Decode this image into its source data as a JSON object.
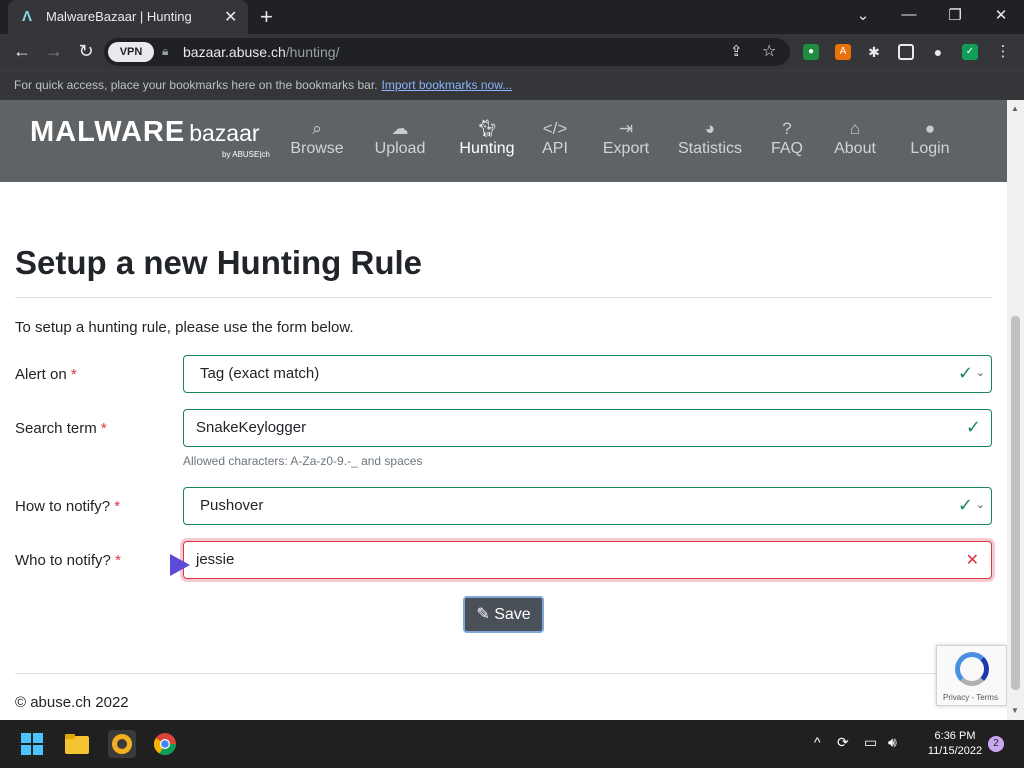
{
  "browser": {
    "tab_title": "MalwareBazaar | Hunting",
    "url_host": "bazaar.abuse.ch",
    "url_path": "/hunting/",
    "vpn_label": "VPN",
    "bookmarks_text": "For quick access, place your bookmarks here on the bookmarks bar.",
    "bookmarks_link": "Import bookmarks now..."
  },
  "site": {
    "logo_main": "MALWARE",
    "logo_sub": "bazaar",
    "logo_by": "by ABUSE|ch",
    "nav": [
      {
        "label": "Browse",
        "icon": "search-icon"
      },
      {
        "label": "Upload",
        "icon": "cloud-upload-icon"
      },
      {
        "label": "Hunting",
        "icon": "cat-icon"
      },
      {
        "label": "API",
        "icon": "code-icon"
      },
      {
        "label": "Export",
        "icon": "file-export-icon"
      },
      {
        "label": "Statistics",
        "icon": "pie-chart-icon"
      },
      {
        "label": "FAQ",
        "icon": "question-icon"
      },
      {
        "label": "About",
        "icon": "building-icon"
      },
      {
        "label": "Login",
        "icon": "user-icon"
      }
    ],
    "active_nav": "Hunting"
  },
  "form": {
    "heading": "Setup a new Hunting Rule",
    "intro": "To setup a hunting rule, please use the form below.",
    "alert_on": {
      "label": "Alert on",
      "value": "Tag (exact match)"
    },
    "search_term": {
      "label": "Search term",
      "value": "SnakeKeylogger",
      "help": "Allowed characters: A-Za-z0-9.-_ and spaces"
    },
    "notify_how": {
      "label": "How to notify?",
      "value": "Pushover"
    },
    "notify_who": {
      "label": "Who to notify?",
      "value": "jessie"
    },
    "required_mark": "*",
    "save_label": "Save"
  },
  "footer": {
    "copyright": "© abuse.ch 2022",
    "recaptcha": "Privacy - Terms"
  },
  "taskbar": {
    "time": "6:36 PM",
    "date": "11/15/2022",
    "notifications": "2"
  },
  "colors": {
    "valid": "#198754",
    "invalid": "#dc3545",
    "nav_bg": "#5f6366"
  }
}
